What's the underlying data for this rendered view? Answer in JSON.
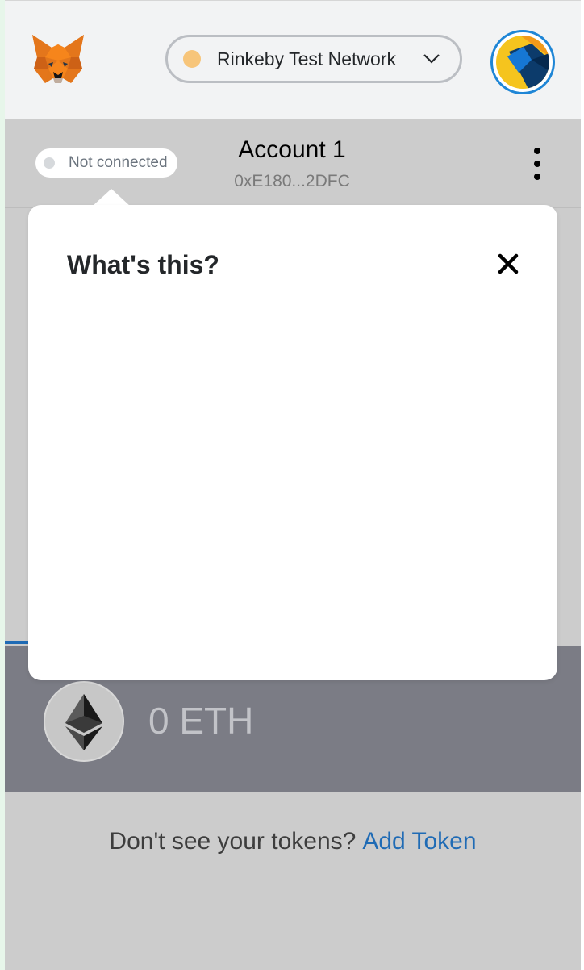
{
  "header": {
    "logo_icon": "metamask-fox-icon",
    "network": {
      "label": "Rinkeby Test Network",
      "dot_color": "#f7c57a",
      "chevron_icon": "chevron-down-icon"
    },
    "avatar_icon": "account-identicon"
  },
  "account": {
    "connection_status": "Not connected",
    "name": "Account 1",
    "address": "0xE180...2DFC",
    "menu_icon": "kebab-menu-icon"
  },
  "popover": {
    "title": "What's this?",
    "close_icon": "close-icon"
  },
  "asset": {
    "icon": "ethereum-icon",
    "balance": "0 ETH"
  },
  "tokens": {
    "prompt": "Don't see your tokens?",
    "add_link": "Add Token"
  },
  "colors": {
    "link": "#1f6bb5",
    "avatar_ring": "#1f86d6",
    "overlay_header": "#f2f3f4"
  }
}
